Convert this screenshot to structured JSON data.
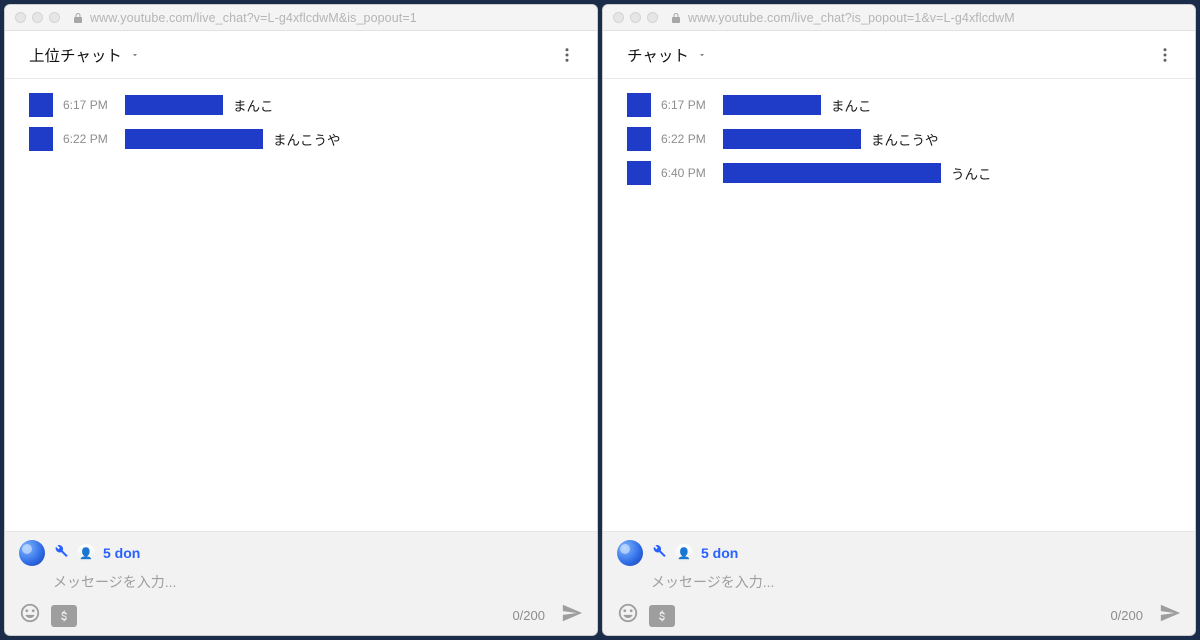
{
  "panels": [
    {
      "url": "www.youtube.com/live_chat?v=L-g4xflcdwM&is_popout=1",
      "mode_label": "上位チャット",
      "messages": [
        {
          "time": "6:17 PM",
          "name_width": 98,
          "text": "まんこ"
        },
        {
          "time": "6:22 PM",
          "name_width": 138,
          "text": "まんこうや"
        }
      ],
      "username": "5 don",
      "placeholder": "メッセージを入力...",
      "counter": "0/200"
    },
    {
      "url": "www.youtube.com/live_chat?is_popout=1&v=L-g4xflcdwM",
      "mode_label": "チャット",
      "messages": [
        {
          "time": "6:17 PM",
          "name_width": 98,
          "text": "まんこ"
        },
        {
          "time": "6:22 PM",
          "name_width": 138,
          "text": "まんこうや"
        },
        {
          "time": "6:40 PM",
          "name_width": 218,
          "text": "うんこ"
        }
      ],
      "username": "5 don",
      "placeholder": "メッセージを入力...",
      "counter": "0/200"
    }
  ]
}
